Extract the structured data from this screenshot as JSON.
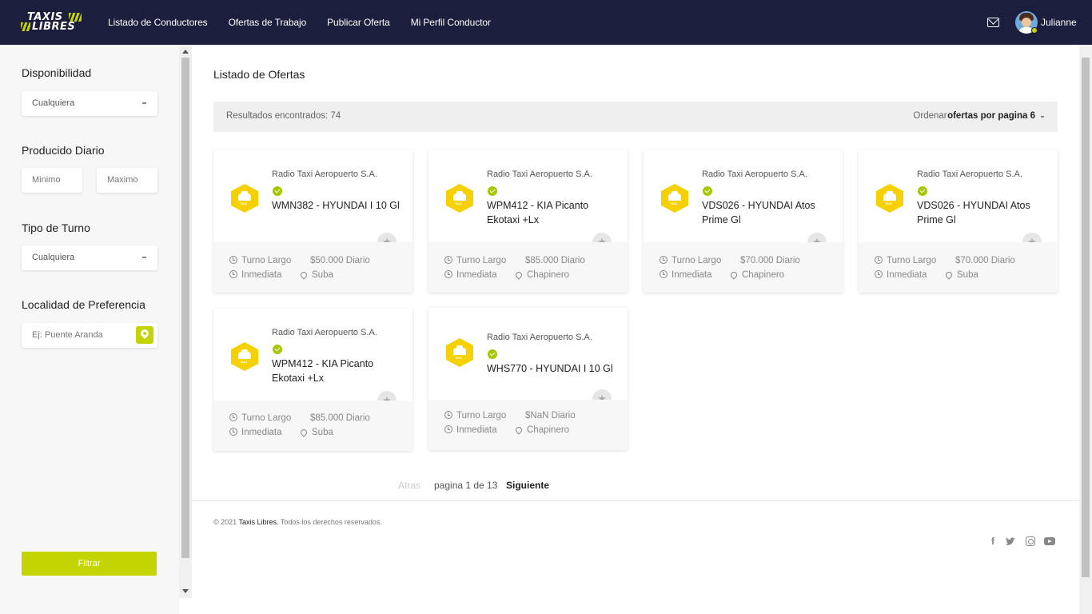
{
  "brand": {
    "line1": "TAXIS",
    "line2": "LIBRES",
    "accent": "#c4d400",
    "nav_bg": "#1b1e3c"
  },
  "nav": {
    "items": [
      "Listado de Conductores",
      "Ofertas de Trabajo",
      "Publicar Oferta",
      "Mi Perfil Conductor"
    ],
    "username": "Julianne"
  },
  "sidebar": {
    "disponibilidad": {
      "label": "Disponibilidad",
      "value": "Cualquiera"
    },
    "producido": {
      "label": "Producido Diario",
      "min_placeholder": "Minimo",
      "max_placeholder": "Maximo"
    },
    "turno": {
      "label": "Tipo de Turno",
      "value": "Cualquiera"
    },
    "localidad": {
      "label": "Localidad de Preferencia",
      "placeholder": "Ej: Puente Aranda"
    },
    "filter_button": "Filtrar"
  },
  "main": {
    "title": "Listado de Ofertas",
    "results": "Resultados encontrados: 74",
    "order_label": "Ordenar :",
    "order_value": "ofertas por pagina 6",
    "offers": [
      {
        "company": "Radio Taxi Aeropuerto S.A.",
        "vehicle": "WMN382 - HYUNDAI I 10 Gl",
        "shift": "Turno Largo",
        "pay": "$50.000 Diario",
        "availability": "Inmediata",
        "locality": "Suba"
      },
      {
        "company": "Radio Taxi Aeropuerto S.A.",
        "vehicle": "WPM412 - KIA Picanto Ekotaxi +Lx",
        "shift": "Turno Largo",
        "pay": "$85.000 Diario",
        "availability": "Inmediata",
        "locality": "Chapinero"
      },
      {
        "company": "Radio Taxi Aeropuerto S.A.",
        "vehicle": "VDS026 - HYUNDAI Atos Prime Gl",
        "shift": "Turno Largo",
        "pay": "$70.000 Diario",
        "availability": "Inmediata",
        "locality": "Chapinero"
      },
      {
        "company": "Radio Taxi Aeropuerto S.A.",
        "vehicle": "VDS026 - HYUNDAI Atos Prime Gl",
        "shift": "Turno Largo",
        "pay": "$70.000 Diario",
        "availability": "Inmediata",
        "locality": "Suba"
      },
      {
        "company": "Radio Taxi Aeropuerto S.A.",
        "vehicle": "WPM412 - KIA Picanto Ekotaxi +Lx",
        "shift": "Turno Largo",
        "pay": "$85.000 Diario",
        "availability": "Inmediata",
        "locality": "Suba"
      },
      {
        "company": "Radio Taxi Aeropuerto S.A.",
        "vehicle": "WHS770 - HYUNDAI I 10 Gl",
        "shift": "Turno Largo",
        "pay": "$NaN Diario",
        "availability": "Inmediata",
        "locality": "Chapinero"
      }
    ],
    "taxi_badge_text": "TAXI",
    "pagination": {
      "prev": "Atras",
      "info": "pagina 1 de 13",
      "next": "Siguiente"
    }
  },
  "footer": {
    "prefix": "© 2021",
    "brand": "Taxis Libres.",
    "rights": "Todos los derechos reservados."
  },
  "icons": [
    "mail-icon",
    "facebook-icon",
    "twitter-icon",
    "instagram-icon",
    "youtube-icon",
    "star-icon",
    "clock-icon",
    "alarm-icon",
    "location-pin-icon",
    "check-icon"
  ]
}
